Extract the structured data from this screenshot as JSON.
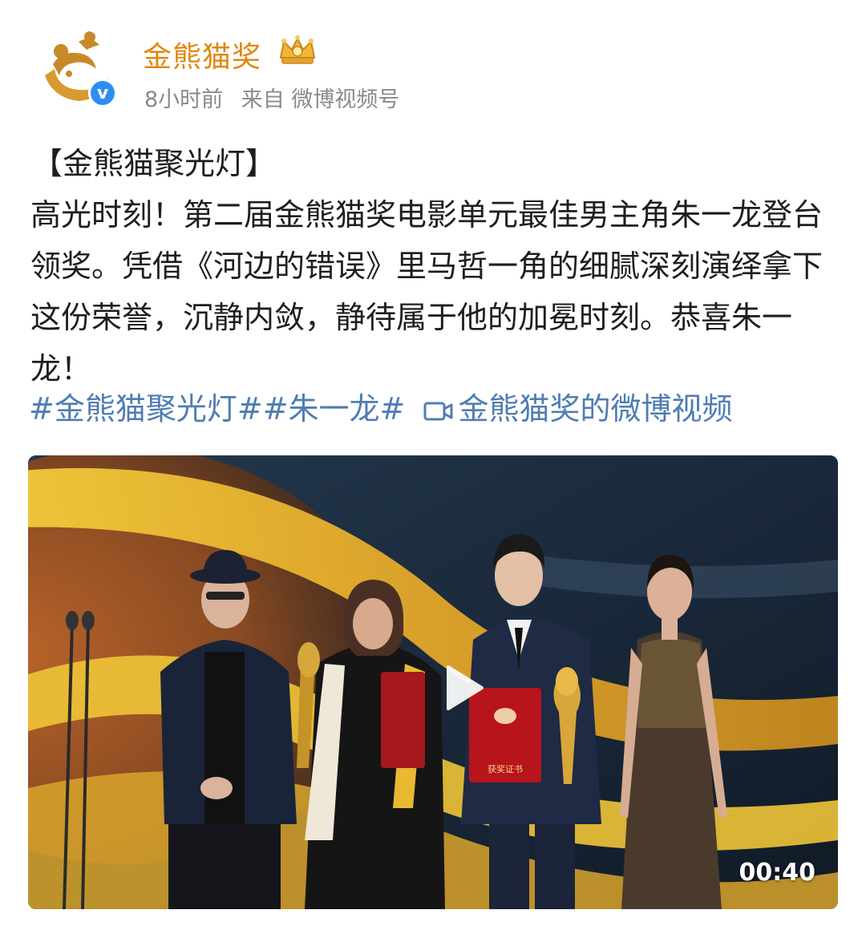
{
  "account": {
    "name": "金熊猫奖",
    "time": "8小时前",
    "source": "来自 微博视频号",
    "verified_icon": "verified-v-icon",
    "badge_icon": "crown-icon",
    "name_color": "#e2860f"
  },
  "post": {
    "title": "【金熊猫聚光灯】",
    "body": "高光时刻！第二届金熊猫奖电影单元最佳男主角朱一龙登台领奖。凭借《河边的错误》里马哲一角的细腻深刻演绎拿下这份荣誉，沉静内敛，静待属于他的加冕时刻。恭喜朱一龙！",
    "hashtags": [
      "#金熊猫聚光灯#",
      "#朱一龙#"
    ],
    "video_link": "金熊猫奖的微博视频",
    "link_color": "#4f7db3"
  },
  "video": {
    "duration": "00:40",
    "play_icon": "play-icon",
    "certificate_text": "获奖证书"
  }
}
